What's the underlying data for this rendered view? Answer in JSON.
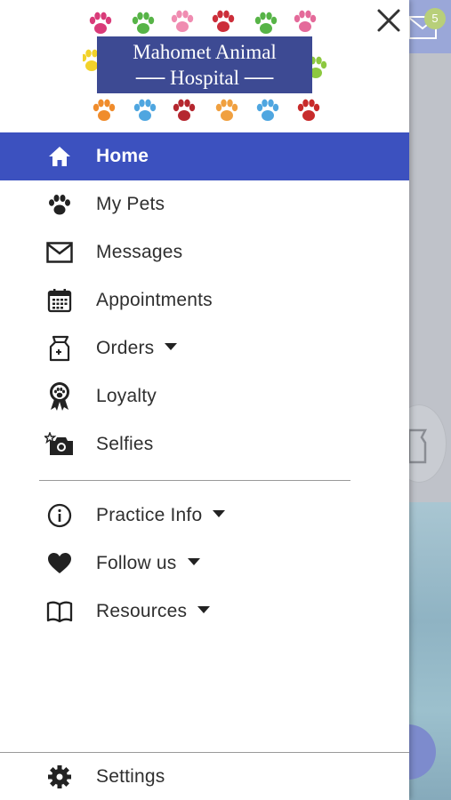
{
  "background": {
    "mail_badge_count": "5"
  },
  "logo": {
    "line1": "Mahomet Animal",
    "line2": "── Hospital ──"
  },
  "colors": {
    "accent": "#3c51bf",
    "logo_plate": "#3d4a93"
  },
  "menu": [
    {
      "label": "Home",
      "icon": "home-icon",
      "active": true
    },
    {
      "label": "My Pets",
      "icon": "paw-icon"
    },
    {
      "label": "Messages",
      "icon": "envelope-icon"
    },
    {
      "label": "Appointments",
      "icon": "calendar-icon"
    },
    {
      "label": "Orders",
      "icon": "pet-food-bag-icon",
      "has_dropdown": true
    },
    {
      "label": "Loyalty",
      "icon": "ribbon-badge-icon"
    },
    {
      "label": "Selfies",
      "icon": "camera-icon"
    }
  ],
  "menu2": [
    {
      "label": "Practice Info",
      "icon": "info-icon",
      "has_dropdown": true
    },
    {
      "label": "Follow us",
      "icon": "heart-icon",
      "has_dropdown": true
    },
    {
      "label": "Resources",
      "icon": "book-icon",
      "has_dropdown": true
    }
  ],
  "footer": {
    "settings_label": "Settings",
    "settings_icon": "gear-icon"
  }
}
